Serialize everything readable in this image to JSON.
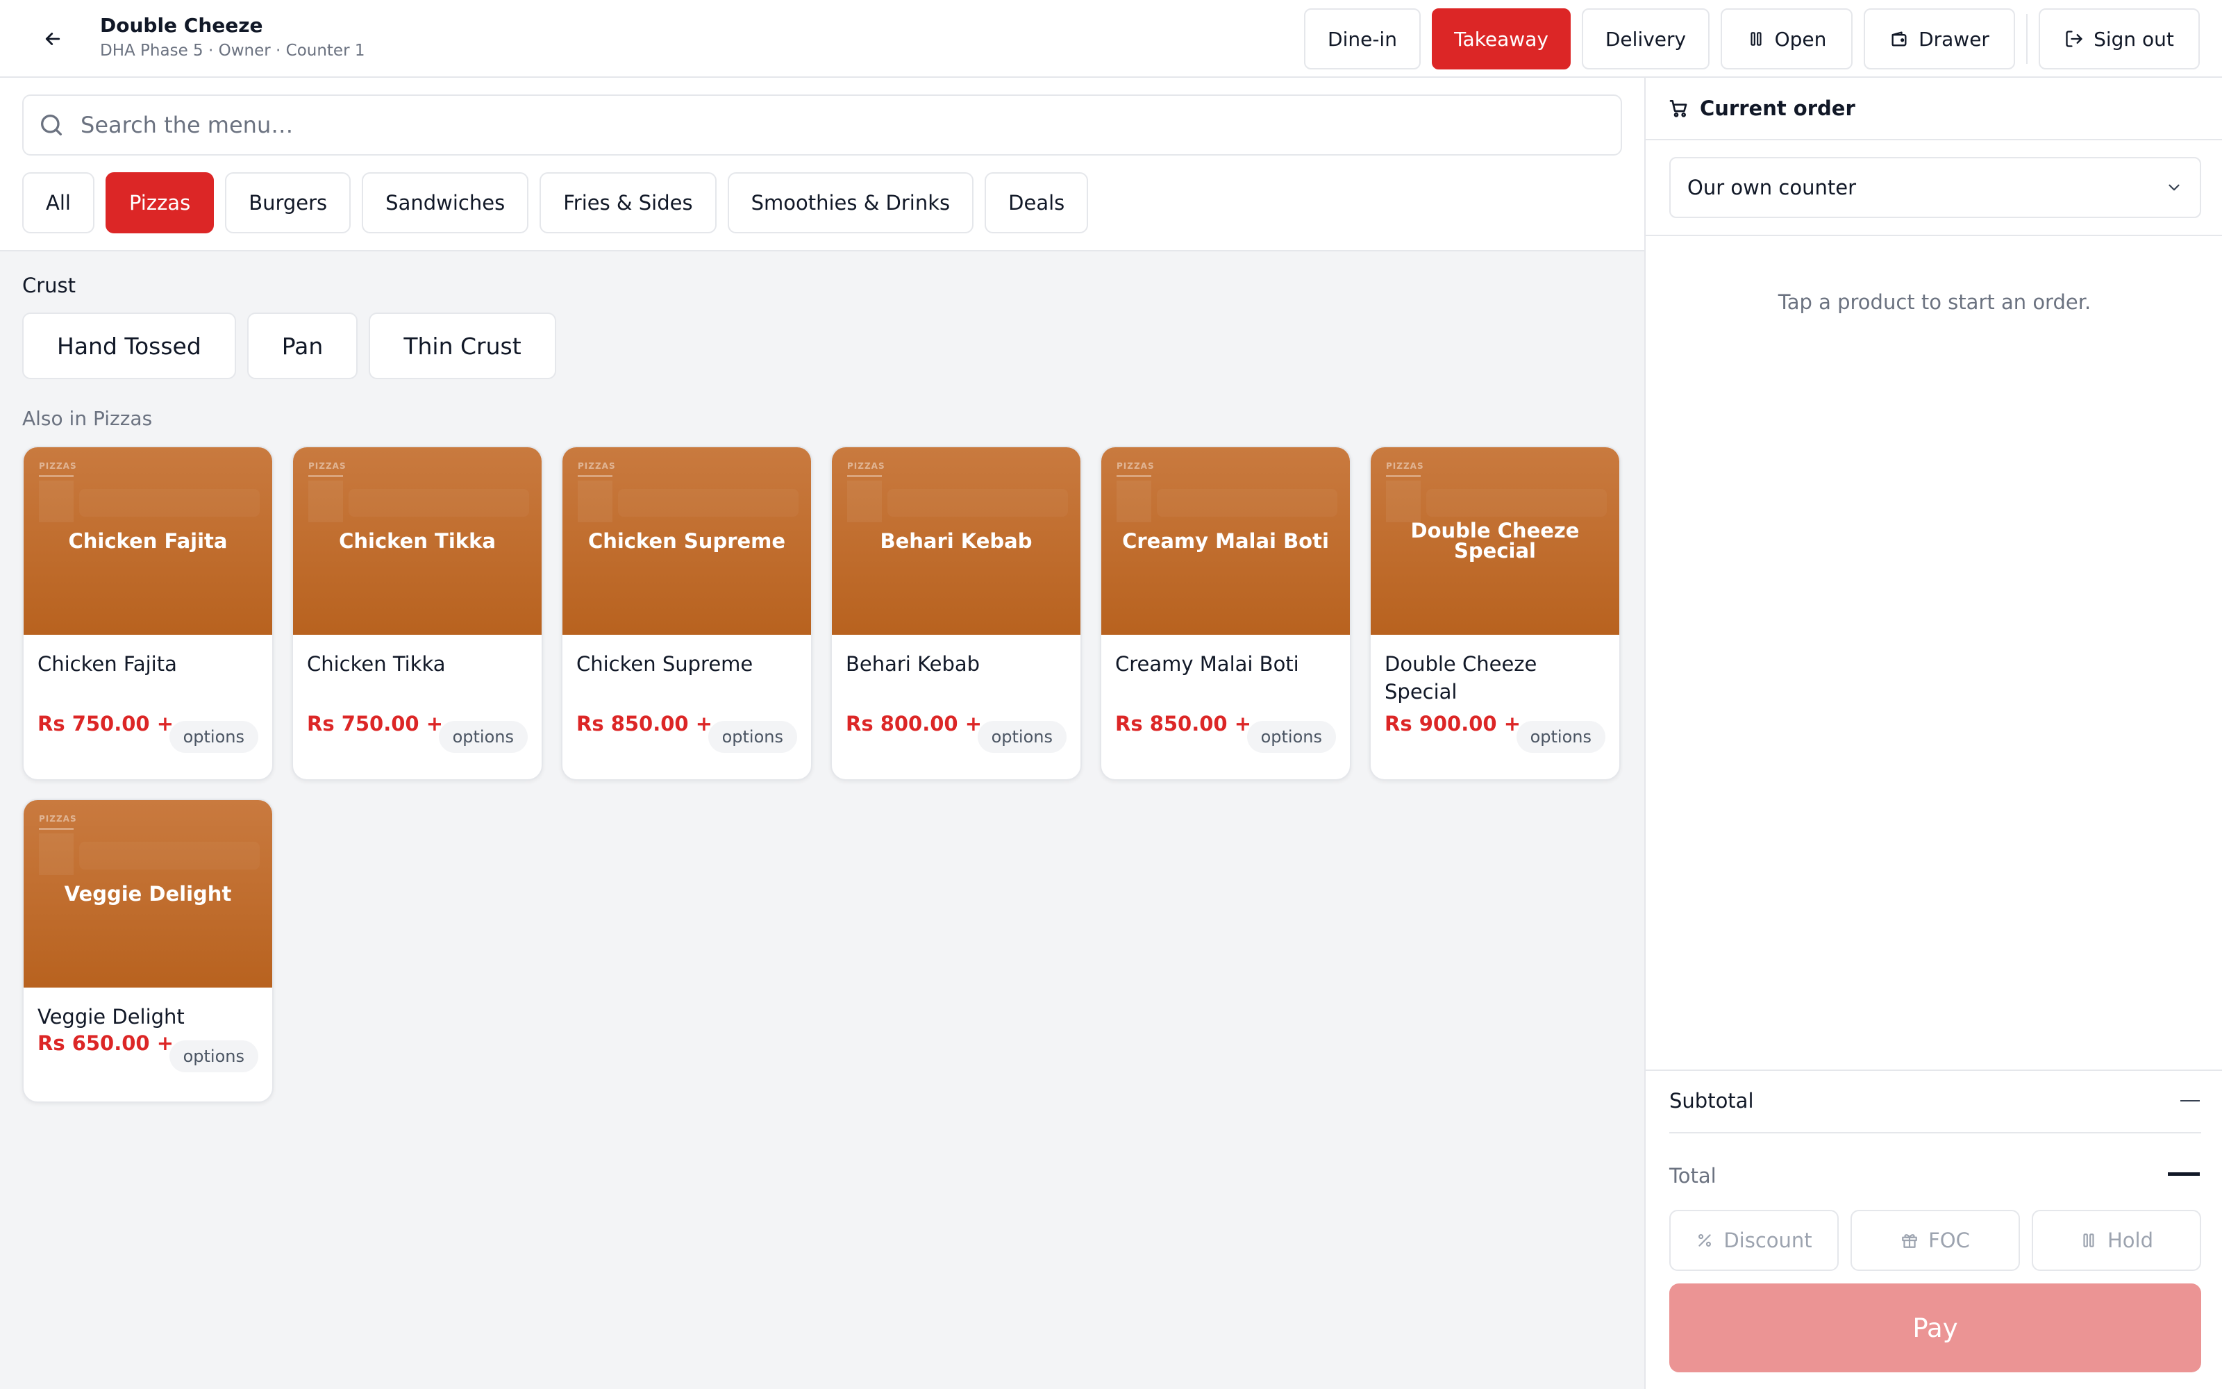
{
  "header": {
    "back_icon": "arrow-left-icon",
    "title": "Double Cheeze",
    "subtitle": "DHA Phase 5 · Owner · Counter 1",
    "order_types": [
      "Dine-in",
      "Takeaway",
      "Delivery"
    ],
    "active_order_type": "Takeaway",
    "open_label": "Open",
    "open_icon": "pause-bars-icon",
    "drawer_label": "Drawer",
    "drawer_icon": "wallet-icon",
    "signout_label": "Sign out",
    "signout_icon": "sign-out-icon",
    "accent_color": "#dc2626"
  },
  "search": {
    "placeholder": "Search the menu…",
    "icon": "search-icon"
  },
  "categories": {
    "items": [
      "All",
      "Pizzas",
      "Burgers",
      "Sandwiches",
      "Fries & Sides",
      "Smoothies & Drinks",
      "Deals"
    ],
    "active": "Pizzas"
  },
  "crust": {
    "label": "Crust",
    "options": [
      "Hand Tossed",
      "Pan",
      "Thin Crust"
    ]
  },
  "section": {
    "title": "Also in Pizzas"
  },
  "products": [
    {
      "thumb_category": "PIZZAS",
      "thumb_title": "Chicken Fajita",
      "name": "Chicken Fajita",
      "price": "Rs 750.00 +",
      "options_label": "options"
    },
    {
      "thumb_category": "PIZZAS",
      "thumb_title": "Chicken Tikka",
      "name": "Chicken Tikka",
      "price": "Rs 750.00 +",
      "options_label": "options"
    },
    {
      "thumb_category": "PIZZAS",
      "thumb_title": "Chicken Supreme",
      "name": "Chicken Supreme",
      "price": "Rs 850.00 +",
      "options_label": "options"
    },
    {
      "thumb_category": "PIZZAS",
      "thumb_title": "Behari Kebab",
      "name": "Behari Kebab",
      "price": "Rs 800.00 +",
      "options_label": "options"
    },
    {
      "thumb_category": "PIZZAS",
      "thumb_title": "Creamy Malai Boti",
      "name": "Creamy Malai Boti",
      "price": "Rs 850.00 +",
      "options_label": "options"
    },
    {
      "thumb_category": "PIZZAS",
      "thumb_title": "Double Cheeze Special",
      "name": "Double Cheeze Special",
      "price": "Rs 900.00 +",
      "options_label": "options"
    },
    {
      "thumb_category": "PIZZAS",
      "thumb_title": "Veggie Delight",
      "name": "Veggie Delight",
      "price": "Rs 650.00 +",
      "options_label": "options"
    }
  ],
  "order": {
    "title": "Current order",
    "icon": "cart-icon",
    "counter_select": "Our own counter",
    "empty_message": "Tap a product to start an order.",
    "subtotal_label": "Subtotal",
    "subtotal_value": "—",
    "total_label": "Total",
    "total_value": "—",
    "actions": [
      {
        "label": "Discount",
        "icon": "percent-icon"
      },
      {
        "label": "FOC",
        "icon": "gift-icon"
      },
      {
        "label": "Hold",
        "icon": "pause-bars-icon"
      }
    ],
    "pay_label": "Pay"
  }
}
